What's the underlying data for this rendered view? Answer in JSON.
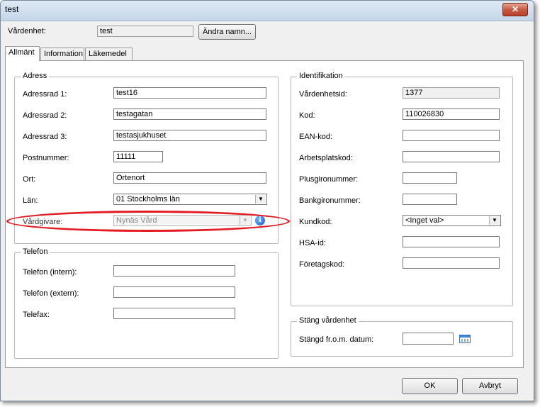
{
  "window": {
    "title": "test"
  },
  "header": {
    "vardenhet_label": "Vårdenhet:",
    "vardenhet_value": "test",
    "rename_button": "Ändra namn..."
  },
  "tabs": [
    {
      "label": "Allmänt",
      "active": true
    },
    {
      "label": "Information",
      "active": false
    },
    {
      "label": "Läkemedel",
      "active": false
    }
  ],
  "adress": {
    "title": "Adress",
    "rows": [
      {
        "label": "Adressrad 1:",
        "value": "test16"
      },
      {
        "label": "Adressrad 2:",
        "value": "testagatan"
      },
      {
        "label": "Adressrad 3:",
        "value": "testasjukhuset"
      },
      {
        "label": "Postnummer:",
        "value": "11111"
      },
      {
        "label": "Ort:",
        "value": "Ortenort"
      },
      {
        "label": "Län:",
        "value": "01 Stockholms län"
      },
      {
        "label": "Vårdgivare:",
        "value": "Nynäs Vård"
      }
    ]
  },
  "telefon": {
    "title": "Telefon",
    "rows": [
      {
        "label": "Telefon (intern):",
        "value": ""
      },
      {
        "label": "Telefon (extern):",
        "value": ""
      },
      {
        "label": "Telefax:",
        "value": ""
      }
    ]
  },
  "identifikation": {
    "title": "Identifikation",
    "rows": [
      {
        "label": "Vårdenhetsid:",
        "value": "1377"
      },
      {
        "label": "Kod:",
        "value": "110026830"
      },
      {
        "label": "EAN-kod:",
        "value": ""
      },
      {
        "label": "Arbetsplatskod:",
        "value": ""
      },
      {
        "label": "Plusgironummer:",
        "value": ""
      },
      {
        "label": "Bankgironummer:",
        "value": ""
      },
      {
        "label": "Kundkod:",
        "value": "<Inget val>"
      },
      {
        "label": "HSA-id:",
        "value": ""
      },
      {
        "label": "Företagskod:",
        "value": ""
      }
    ]
  },
  "stang": {
    "title": "Stäng vårdenhet",
    "label": "Stängd fr.o.m. datum:",
    "value": ""
  },
  "footer": {
    "ok": "OK",
    "cancel": "Avbryt"
  },
  "colors": {
    "highlight": "#e21b23",
    "info": "#1f5fc0"
  }
}
